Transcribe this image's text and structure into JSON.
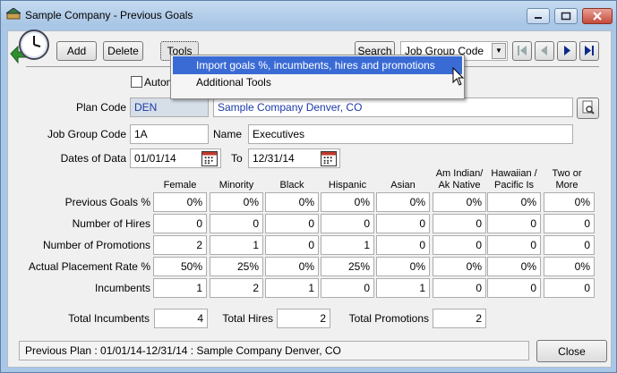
{
  "window": {
    "title": "Sample Company - Previous Goals"
  },
  "toolbar": {
    "add": "Add",
    "delete": "Delete",
    "tools": "Tools",
    "search": "Search",
    "search_field": "Job Group Code"
  },
  "tools_menu": {
    "items": [
      {
        "label": "Import goals %, incumbents, hires and promotions"
      },
      {
        "label": "Additional Tools"
      }
    ]
  },
  "form": {
    "auto_label": "Autom",
    "plan_code_label": "Plan Code",
    "plan_code": "DEN",
    "plan_name": "Sample Company Denver, CO",
    "job_group_code_label": "Job Group Code",
    "job_group_code": "1A",
    "name_label": "Name",
    "name": "Executives",
    "dates_label": "Dates of Data",
    "date_from": "01/01/14",
    "to_label": "To",
    "date_to": "12/31/14"
  },
  "table": {
    "columns": [
      {
        "label": "Female"
      },
      {
        "label": "Minority"
      },
      {
        "label": "Black"
      },
      {
        "label": "Hispanic"
      },
      {
        "label": "Asian"
      },
      {
        "label": "Am Indian/ Ak Native"
      },
      {
        "label": "Hawaiian / Pacific Is"
      },
      {
        "label": "Two or More"
      }
    ],
    "rows": [
      {
        "label": "Previous Goals %",
        "values": [
          "0%",
          "0%",
          "0%",
          "0%",
          "0%",
          "0%",
          "0%",
          "0%"
        ]
      },
      {
        "label": "Number of Hires",
        "values": [
          "0",
          "0",
          "0",
          "0",
          "0",
          "0",
          "0",
          "0"
        ]
      },
      {
        "label": "Number of Promotions",
        "values": [
          "2",
          "1",
          "0",
          "1",
          "0",
          "0",
          "0",
          "0"
        ]
      },
      {
        "label": "Actual Placement Rate %",
        "values": [
          "50%",
          "25%",
          "0%",
          "25%",
          "0%",
          "0%",
          "0%",
          "0%"
        ]
      },
      {
        "label": "Incumbents",
        "values": [
          "1",
          "2",
          "1",
          "0",
          "1",
          "0",
          "0",
          "0"
        ]
      }
    ]
  },
  "totals": {
    "incumbents_label": "Total Incumbents",
    "incumbents": "4",
    "hires_label": "Total Hires",
    "hires": "2",
    "promotions_label": "Total Promotions",
    "promotions": "2"
  },
  "footer": {
    "status": "Previous Plan : 01/01/14-12/31/14 : Sample Company Denver, CO",
    "close": "Close"
  }
}
